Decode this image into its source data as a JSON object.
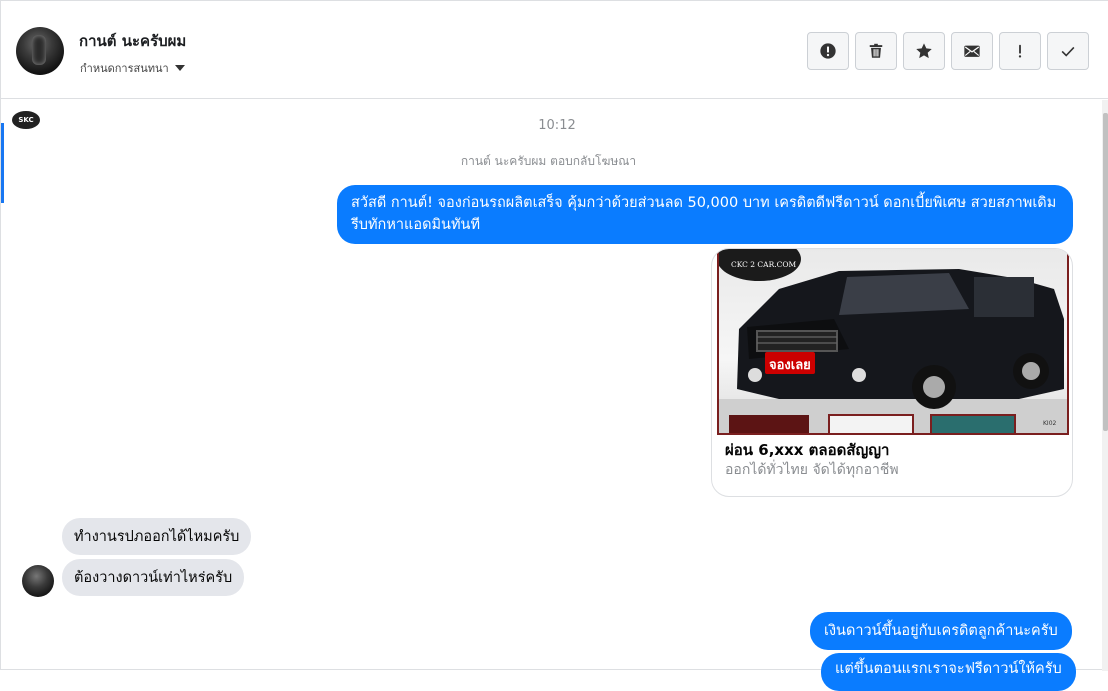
{
  "header": {
    "contact_name": "กานต์ นะครับผม",
    "assign_label": "กำหนดการสนทนา",
    "actions": [
      {
        "icon": "alert-circle-icon",
        "name": "mark-spam-button"
      },
      {
        "icon": "trash-icon",
        "name": "delete-button"
      },
      {
        "icon": "star-icon",
        "name": "star-button"
      },
      {
        "icon": "envelope-icon",
        "name": "mark-unread-button"
      },
      {
        "icon": "exclamation-icon",
        "name": "follow-up-button"
      },
      {
        "icon": "check-icon",
        "name": "mark-done-button"
      }
    ]
  },
  "conversation": {
    "page_logo_text": "SKC",
    "time": "10:12",
    "reply_note": "กานต์ นะครับผม ตอบกลับโฆษณา",
    "messages_out": [
      "สวัสดี กานต์! จองก่อนรถผลิตเสร็จ คุ้มกว่าด้วยส่วนลด 50,000 บาท เครดิตดีฟรีดาวน์ ดอกเบี้ยพิเศษ สวยสภาพเดิม รีบทักหาแอดมินทันที",
      "เงินดาวน์ขึ้นอยู่กับเครดิตลูกค้านะครับ",
      "แต่ขึ้นตอนแรกเราจะฟรีดาวน์ให้ครับ"
    ],
    "messages_in": [
      "ทำงานรปภออกได้ไหมครับ",
      "ต้องวางดาวน์เท่าไหร่ครับ"
    ],
    "ad_card": {
      "image_brand": "CKC 2 CAR.COM",
      "image_badge": "จองเลย",
      "image_code": "KI02",
      "title": "ผ่อน 6,xxx ตลอดสัญญา",
      "subtitle": "ออกได้ทั่วไทย จัดได้ทุกอาชีพ"
    }
  },
  "colors": {
    "outgoing_bubble": "#0a7cff",
    "incoming_bubble": "#e4e6eb",
    "accent": "#1877f2"
  }
}
